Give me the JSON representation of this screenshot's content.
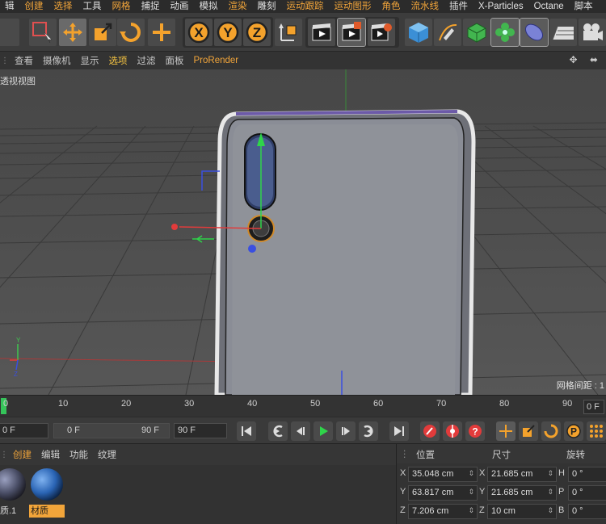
{
  "menubar": {
    "items": [
      "辑",
      "创建",
      "选择",
      "工具",
      "网格",
      "捕捉",
      "动画",
      "模拟",
      "渲染",
      "雕刻",
      "运动跟踪",
      "运动图形",
      "角色",
      "流水线",
      "插件",
      "X-Particles",
      "Octane",
      "脚本"
    ]
  },
  "toolbar": {
    "icons": [
      "render-region-icon",
      "move-icon",
      "scale-icon",
      "rotate-icon",
      "transform-icon",
      "x-axis-icon",
      "y-axis-icon",
      "z-axis-icon",
      "coordinate-system-icon",
      "render-view-icon",
      "render-picture-viewer-icon",
      "render-settings-icon",
      "cube-icon",
      "pen-icon",
      "subdivision-icon",
      "cloner-icon",
      "deformer-icon",
      "floor-icon",
      "camera-icon"
    ],
    "axis_labels": [
      "X",
      "Y",
      "Z"
    ]
  },
  "viewbar": {
    "items": [
      "查看",
      "摄像机",
      "显示",
      "选项",
      "过滤",
      "面板",
      "ProRender"
    ],
    "selected": "选项"
  },
  "viewport": {
    "label": "透视视图",
    "grid_label": "网格间距 : 1"
  },
  "timeline": {
    "ticks": [
      "0",
      "10",
      "20",
      "30",
      "40",
      "50",
      "60",
      "70",
      "80",
      "90"
    ],
    "end_frame": "0 F"
  },
  "transport": {
    "current_frame": "0 F",
    "range_start": "0 F",
    "range_end": "90 F",
    "max_frame": "90 F"
  },
  "materials": {
    "tabs": [
      "创建",
      "编辑",
      "功能",
      "纹理"
    ],
    "items": [
      {
        "label": "质.1",
        "selected": false,
        "color": "#4a4e66"
      },
      {
        "label": "材质",
        "selected": true,
        "color": "#2a64b4"
      }
    ]
  },
  "coordinates": {
    "headers": [
      "位置",
      "尺寸",
      "旋转"
    ],
    "rows": [
      {
        "axis": "X",
        "pos": "35.048 cm",
        "size_axis": "X",
        "size": "21.685 cm",
        "rot_axis": "H",
        "rot": "0 °"
      },
      {
        "axis": "Y",
        "pos": "63.817 cm",
        "size_axis": "Y",
        "size": "21.685 cm",
        "rot_axis": "P",
        "rot": "0 °"
      },
      {
        "axis": "Z",
        "pos": "7.206 cm",
        "size_axis": "Z",
        "size": "10 cm",
        "rot_axis": "B",
        "rot": "0 °"
      }
    ]
  },
  "colors": {
    "accent_orange": "#f2a53a",
    "axis_red": "#e23b3b",
    "axis_green": "#2fd54a",
    "axis_blue": "#3a4fe0"
  }
}
